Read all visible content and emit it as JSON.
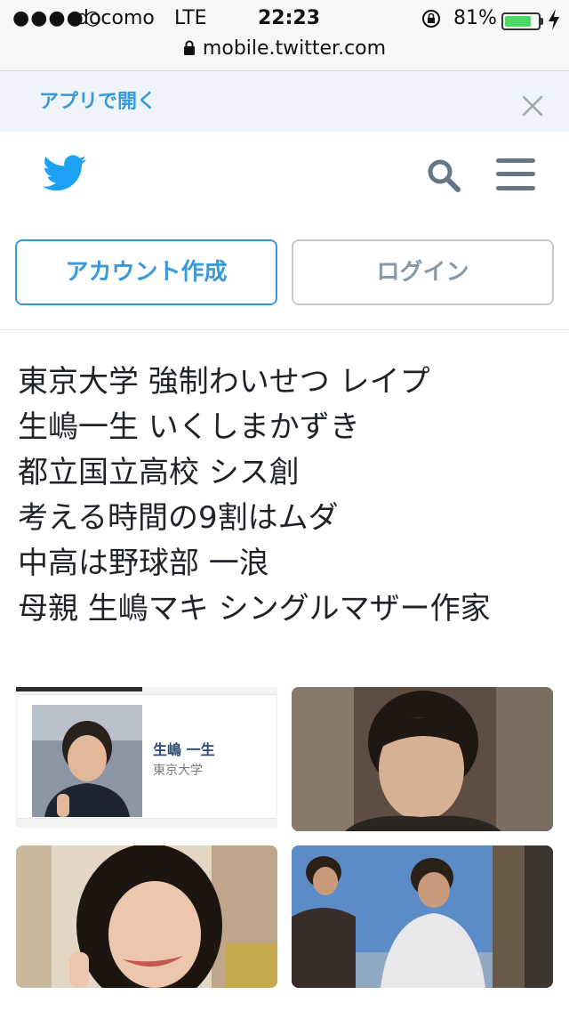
{
  "status_bar": {
    "signal": "●●●●○",
    "carrier": "docomo",
    "network": "LTE",
    "time": "22:23",
    "battery_percent": "81%",
    "battery_level": 0.81,
    "url": "mobile.twitter.com"
  },
  "app_banner": {
    "open_in_app": "アプリで開く"
  },
  "auth": {
    "signup_label": "アカウント作成",
    "login_label": "ログイン"
  },
  "tweet": {
    "lines": [
      "東京大学 強制わいせつ レイプ",
      "生嶋一生 いくしまかずき",
      "都立国立高校 シス創",
      "考える時間の9割はムダ",
      "中高は野球部 一浪",
      "母親 生嶋マキ シングルマザー作家"
    ],
    "media": {
      "profile_card_name": "生嶋 一生",
      "profile_card_school": "東京大学"
    }
  },
  "colors": {
    "brand": "#1da1f2",
    "accent": "#3a9ad9",
    "banner_bg": "#eef4fa",
    "icon_gray": "#657786"
  },
  "icons": [
    "lock-icon",
    "rotation-lock-icon",
    "battery-icon",
    "bolt-icon",
    "close-icon",
    "twitter-bird-icon",
    "search-icon",
    "menu-icon"
  ]
}
